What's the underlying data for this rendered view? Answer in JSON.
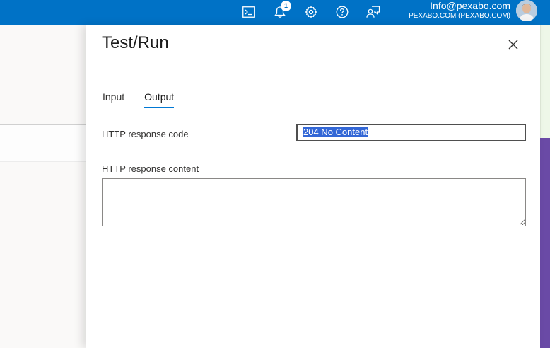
{
  "topbar": {
    "icons": [
      "terminal-icon",
      "bell-icon",
      "gear-icon",
      "help-icon",
      "feedback-icon"
    ],
    "notification_count": "1",
    "account_email": "Info@pexabo.com",
    "account_tenant": "PEXABO.COM (PEXABO.COM)",
    "brand_color": "#0072c6"
  },
  "blade": {
    "title": "Test/Run",
    "tabs": [
      {
        "label": "Input",
        "active": false
      },
      {
        "label": "Output",
        "active": true
      }
    ],
    "response_code_label": "HTTP response code",
    "response_code_value": "204 No Content",
    "response_content_label": "HTTP response content",
    "response_content_value": ""
  }
}
